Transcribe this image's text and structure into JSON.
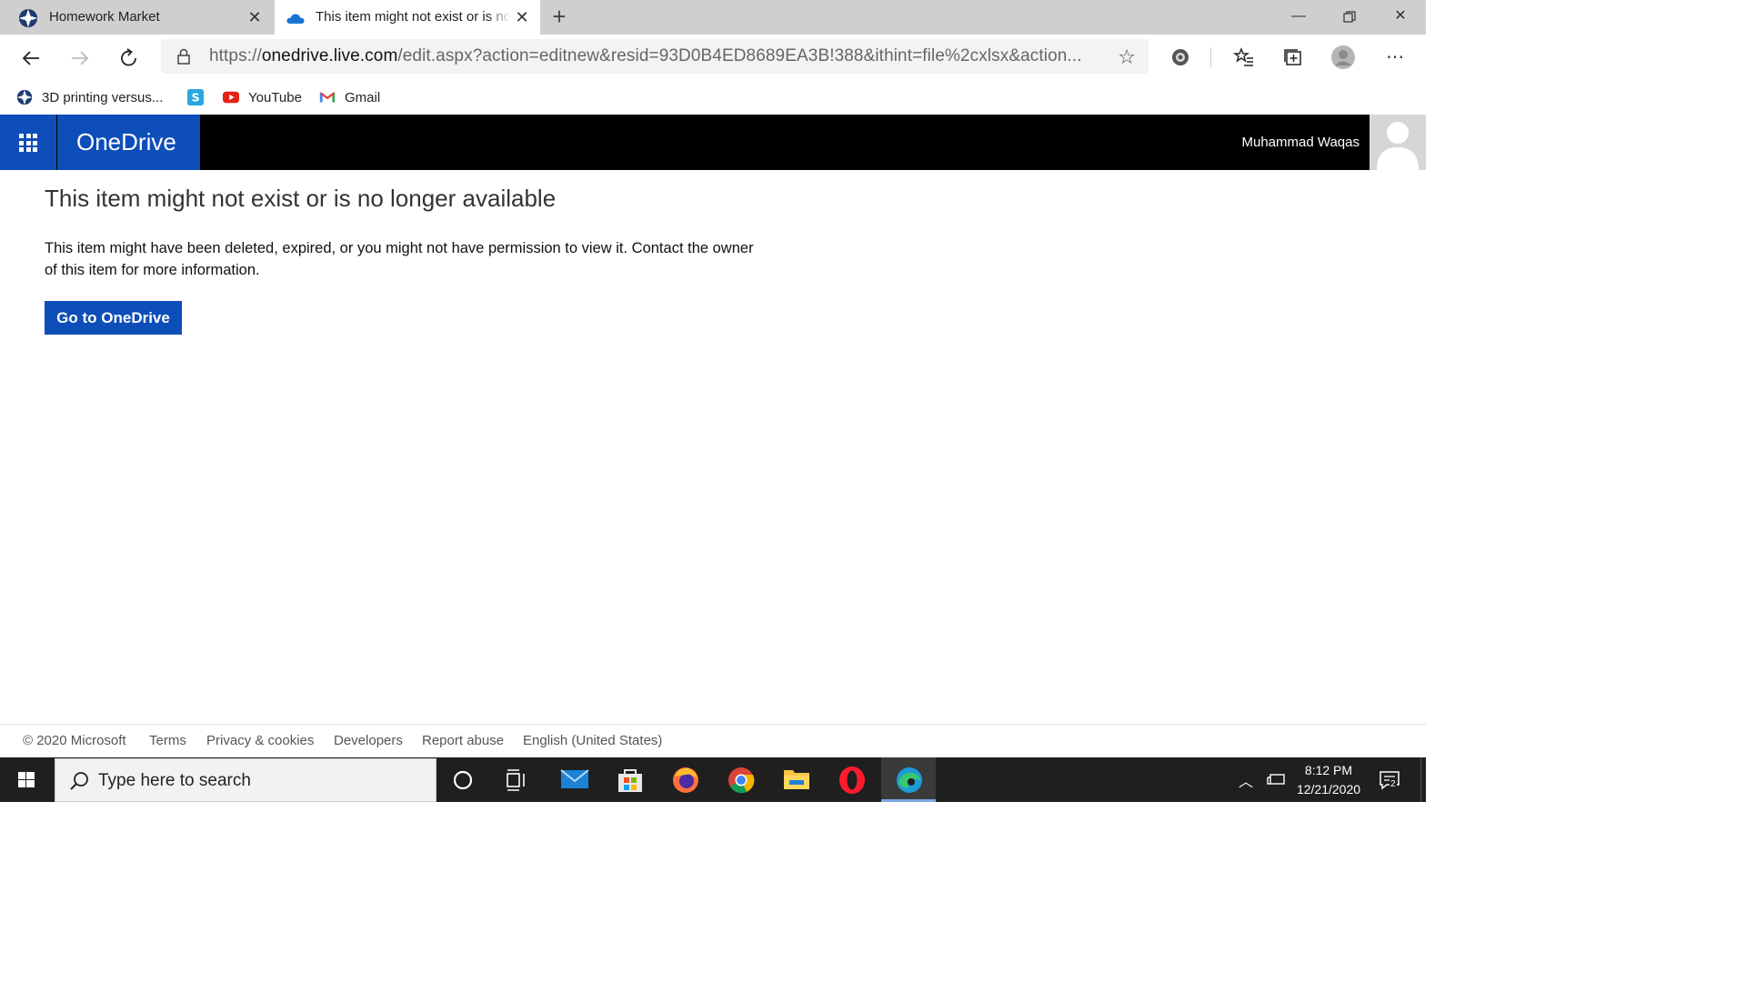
{
  "tabs": [
    {
      "title": "Homework Market",
      "active": false
    },
    {
      "title": "This item might not exist or is no longer available",
      "active": true
    }
  ],
  "address_bar": {
    "url_scheme": "https://",
    "url_host": "onedrive.live.com",
    "url_rest": "/edit.aspx?action=editnew&resid=93D0B4ED8689EA3B!388&ithint=file%2cxlsx&action..."
  },
  "bookmarks": [
    {
      "label": "3D printing versus...",
      "icon": "homework-market-icon"
    },
    {
      "label": "",
      "icon": "skype-icon"
    },
    {
      "label": "YouTube",
      "icon": "youtube-icon"
    },
    {
      "label": "Gmail",
      "icon": "gmail-icon"
    }
  ],
  "onedrive_header": {
    "brand": "OneDrive",
    "user_name": "Muhammad Waqas"
  },
  "main": {
    "heading": "This item might not exist or is no longer available",
    "message": "This item might have been deleted, expired, or you might not have permission to view it. Contact the owner of this item for more information.",
    "button_label": "Go to OneDrive"
  },
  "footer": {
    "copyright": "© 2020 Microsoft",
    "links": [
      "Terms",
      "Privacy & cookies",
      "Developers",
      "Report abuse",
      "English (United States)"
    ]
  },
  "taskbar": {
    "search_placeholder": "Type here to search",
    "time": "8:12 PM",
    "date": "12/21/2020",
    "notification_count": "2",
    "apps": [
      "cortana",
      "task-view",
      "mail",
      "microsoft-store",
      "firefox",
      "chrome",
      "file-explorer",
      "opera",
      "edge"
    ]
  },
  "colors": {
    "onedrive_blue": "#0e4eb8",
    "header_black": "#000000",
    "taskbar": "#1f1f1f"
  }
}
